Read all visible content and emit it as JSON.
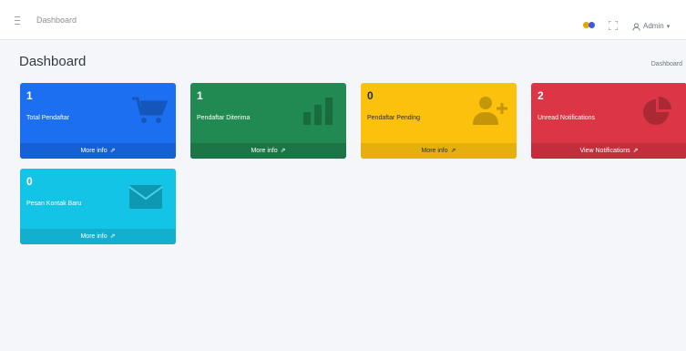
{
  "header": {
    "breadcrumb_link": "Dashboard",
    "user_name": "Admin",
    "user_caret": "▾"
  },
  "page": {
    "title": "Dashboard",
    "breadcrumb": "Dashboard"
  },
  "cards": [
    {
      "value": "1",
      "label": "Total Pendaftar",
      "footer": "More info",
      "icon": "cart-icon",
      "color": "#1b6ff0"
    },
    {
      "value": "1",
      "label": "Pendaftar Diterima",
      "footer": "More info",
      "icon": "bar-chart-icon",
      "color": "#218a52"
    },
    {
      "value": "0",
      "label": "Pendaftar Pending",
      "footer": "More info",
      "icon": "user-plus-icon",
      "color": "#fcc10d"
    },
    {
      "value": "2",
      "label": "Unread Notifications",
      "footer": "View Notifications",
      "icon": "pie-chart-icon",
      "color": "#dc3545"
    },
    {
      "value": "0",
      "label": "Pesan Kontak Baru",
      "footer": "More info",
      "icon": "envelope-icon",
      "color": "#13c4e6"
    }
  ],
  "footer_arrow": "⇗"
}
